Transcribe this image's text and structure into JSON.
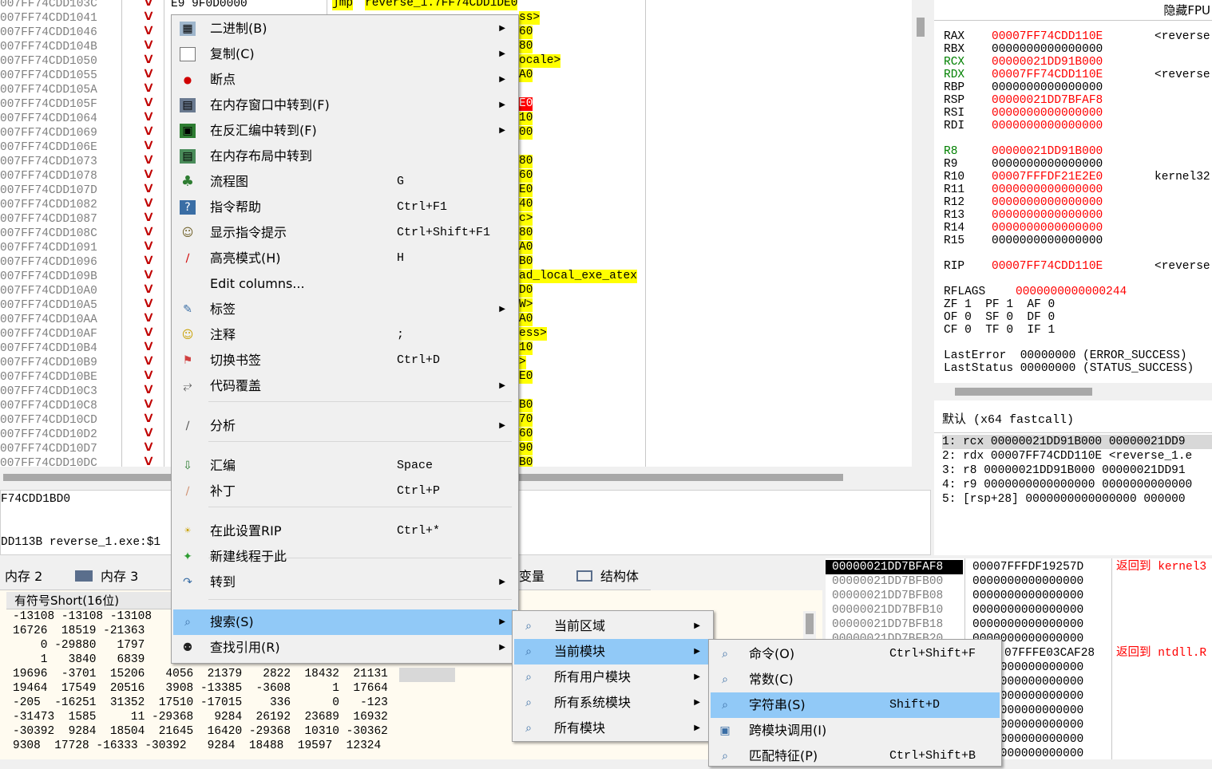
{
  "disasm": {
    "addresses": [
      "007FF74CDD103C",
      "007FF74CDD1041",
      "007FF74CDD1046",
      "007FF74CDD104B",
      "007FF74CDD1050",
      "007FF74CDD1055",
      "007FF74CDD105A",
      "007FF74CDD105F",
      "007FF74CDD1064",
      "007FF74CDD1069",
      "007FF74CDD106E",
      "007FF74CDD1073",
      "007FF74CDD1078",
      "007FF74CDD107D",
      "007FF74CDD1082",
      "007FF74CDD1087",
      "007FF74CDD108C",
      "007FF74CDD1091",
      "007FF74CDD1096",
      "007FF74CDD109B",
      "007FF74CDD10A0",
      "007FF74CDD10A5",
      "007FF74CDD10AA",
      "007FF74CDD10AF",
      "007FF74CDD10B4",
      "007FF74CDD10B9",
      "007FF74CDD10BE",
      "007FF74CDD10C3",
      "007FF74CDD10C8",
      "007FF74CDD10CD",
      "007FF74CDD10D2",
      "007FF74CDD10D7",
      "007FF74CDD10DC"
    ],
    "top_bytes": "E9 9F0D0000",
    "top_jmp": "jmp",
    "top_target": "reverse_1.7FF74CDD1DE0",
    "right_fragments": [
      "ss>",
      "60",
      "80",
      "ocale>",
      "A0",
      "",
      "E0",
      "10",
      "00",
      "",
      "80",
      "60",
      "E0",
      "40",
      "c>",
      "80",
      "A0",
      "B0",
      "ad_local_exe_atex",
      "D0",
      "W>",
      "A0",
      "ess>",
      "10",
      ">",
      "E0",
      "",
      "B0",
      "70",
      "60",
      "90",
      "B0"
    ]
  },
  "info": {
    "line1": "F74CDD1BD0",
    "line2": "DD113B reverse_1.exe:$1"
  },
  "regs": {
    "hide_fpu": "隐藏FPU",
    "rows": [
      {
        "n": "RAX",
        "v": "00007FF74CDD110E",
        "c": "<reverse"
      },
      {
        "n": "RBX",
        "v": "0000000000000000",
        "c": ""
      },
      {
        "n": "RCX",
        "v": "00000021DD91B000",
        "c": ""
      },
      {
        "n": "RDX",
        "v": "00007FF74CDD110E",
        "c": "<reverse"
      },
      {
        "n": "RBP",
        "v": "0000000000000000",
        "c": ""
      },
      {
        "n": "RSP",
        "v": "00000021DD7BFAF8",
        "c": ""
      },
      {
        "n": "RSI",
        "v": "0000000000000000",
        "c": ""
      },
      {
        "n": "RDI",
        "v": "0000000000000000",
        "c": ""
      },
      {
        "n": "R8",
        "v": "00000021DD91B000",
        "c": ""
      },
      {
        "n": "R9",
        "v": "0000000000000000",
        "c": ""
      },
      {
        "n": "R10",
        "v": "00007FFFDF21E2E0",
        "c": "kernel32"
      },
      {
        "n": "R11",
        "v": "0000000000000000",
        "c": ""
      },
      {
        "n": "R12",
        "v": "0000000000000000",
        "c": ""
      },
      {
        "n": "R13",
        "v": "0000000000000000",
        "c": ""
      },
      {
        "n": "R14",
        "v": "0000000000000000",
        "c": ""
      },
      {
        "n": "R15",
        "v": "0000000000000000",
        "c": ""
      },
      {
        "n": "RIP",
        "v": "00007FF74CDD110E",
        "c": "<reverse"
      }
    ],
    "rflags_label": "RFLAGS",
    "rflags": "0000000000000244",
    "flags1": "ZF 1  PF 1  AF 0",
    "flags2": "OF 0  SF 0  DF 0",
    "flags3": "CF 0  TF 0  IF 1",
    "lasterror": "LastError  00000000 (ERROR_SUCCESS)",
    "laststatus": "LastStatus 00000000 (STATUS_SUCCESS)"
  },
  "callconv": {
    "label": "默认 (x64 fastcall)",
    "args": [
      "1: rcx 00000021DD91B000 00000021DD9",
      "2: rdx 00007FF74CDD110E <reverse_1.e",
      "3: r8 00000021DD91B000 00000021DD91",
      "4: r9 0000000000000000 0000000000000",
      "5: [rsp+28] 0000000000000000 000000"
    ]
  },
  "tabs": [
    "内存 2",
    "内存 3",
    "变量",
    "结构体"
  ],
  "dump": {
    "header": "有符号Short(16位)",
    "rows": [
      "-13108 -13108 -13108",
      "16726  18519 -21363",
      "    0 -29880   1797",
      "    1   3840   6839",
      "19696  -3701  15206   4056  21379   2822  18432  21131",
      "19464  17549  20516   3908 -13385  -3608      1  17664",
      "-205  -16251  31352  17510 -17015    336      0   -123",
      "-31473  1585     11 -29368   9284  26192  23689  16932",
      "-30392  9284  18504  21645  16420 -29368  10310 -30362",
      "9308  17728 -16333 -30392   9284  18488  19597  12324"
    ]
  },
  "stack": {
    "addrs": [
      "00000021DD7BFAF8",
      "00000021DD7BFB00",
      "00000021DD7BFB08",
      "00000021DD7BFB10",
      "00000021DD7BFB18",
      "00000021DD7BFB20"
    ],
    "values": [
      "00007FFFDF19257D",
      "0000000000000000",
      "0000000000000000",
      "0000000000000000",
      "0000000000000000",
      "0000000000000000",
      "07FFFE03CAF28",
      "0000000000000000",
      "0000000000000000",
      "0000000000000000",
      "0000000000000000",
      "0000000000000000",
      "0000000000000000",
      "0000000000000000"
    ],
    "comment1": "返回到 kernel3",
    "comment2": "返回到 ntdll.R"
  },
  "menu1": [
    {
      "label": "二进制(B)",
      "sc": "",
      "sub": true,
      "icon": "binary-icon"
    },
    {
      "label": "复制(C)",
      "sc": "",
      "sub": true,
      "icon": "copy-icon"
    },
    {
      "label": "断点",
      "sc": "",
      "sub": true,
      "icon": "breakpoint-icon"
    },
    {
      "label": "在内存窗口中转到(F)",
      "sc": "",
      "sub": true,
      "icon": "memory-goto-icon"
    },
    {
      "label": "在反汇编中转到(F)",
      "sc": "",
      "sub": true,
      "icon": "disasm-goto-icon"
    },
    {
      "label": "在内存布局中转到",
      "sc": "",
      "sub": false,
      "icon": "memmap-icon"
    },
    {
      "label": "流程图",
      "sc": "G",
      "sub": false,
      "icon": "graph-icon"
    },
    {
      "label": "指令帮助",
      "sc": "Ctrl+F1",
      "sub": false,
      "icon": "help-icon"
    },
    {
      "label": "显示指令提示",
      "sc": "Ctrl+Shift+F1",
      "sub": false,
      "icon": "tip-icon"
    },
    {
      "label": "高亮模式(H)",
      "sc": "H",
      "sub": false,
      "icon": "highlight-icon"
    },
    {
      "label": "Edit columns...",
      "sc": "",
      "sub": false,
      "icon": ""
    },
    {
      "label": "标签",
      "sc": "",
      "sub": true,
      "icon": "label-icon"
    },
    {
      "label": "注释",
      "sc": ";",
      "sub": false,
      "icon": "comment-icon"
    },
    {
      "label": "切换书签",
      "sc": "Ctrl+D",
      "sub": false,
      "icon": "bookmark-icon"
    },
    {
      "label": "代码覆盖",
      "sc": "",
      "sub": true,
      "icon": "coverage-icon"
    },
    {
      "label": "分析",
      "sc": "",
      "sub": true,
      "icon": "analyze-icon"
    },
    {
      "label": "汇编",
      "sc": "Space",
      "sub": false,
      "icon": "assemble-icon"
    },
    {
      "label": "补丁",
      "sc": "Ctrl+P",
      "sub": false,
      "icon": "patch-icon"
    },
    {
      "label": "在此设置RIP",
      "sc": "Ctrl+*",
      "sub": false,
      "icon": "set-rip-icon"
    },
    {
      "label": "新建线程于此",
      "sc": "",
      "sub": false,
      "icon": "new-thread-icon"
    },
    {
      "label": "转到",
      "sc": "",
      "sub": true,
      "icon": "goto-icon"
    },
    {
      "label": "搜索(S)",
      "sc": "",
      "sub": true,
      "icon": "search-icon"
    },
    {
      "label": "查找引用(R)",
      "sc": "",
      "sub": true,
      "icon": "find-references-icon"
    }
  ],
  "menu2": [
    {
      "label": "当前区域",
      "icon": "search-region-icon"
    },
    {
      "label": "当前模块",
      "icon": "search-module-icon"
    },
    {
      "label": "所有用户模块",
      "icon": "search-user-modules-icon"
    },
    {
      "label": "所有系统模块",
      "icon": "search-system-modules-icon"
    },
    {
      "label": "所有模块",
      "icon": "search-all-modules-icon"
    }
  ],
  "menu3": [
    {
      "label": "命令(O)",
      "sc": "Ctrl+Shift+F",
      "icon": "command-search-icon"
    },
    {
      "label": "常数(C)",
      "sc": "",
      "icon": "constant-search-icon"
    },
    {
      "label": "字符串(S)",
      "sc": "Shift+D",
      "icon": "string-search-icon"
    },
    {
      "label": "跨模块调用(I)",
      "sc": "",
      "icon": "intermodular-call-icon"
    },
    {
      "label": "匹配特征(P)",
      "sc": "Ctrl+Shift+B",
      "icon": "pattern-search-icon"
    }
  ]
}
